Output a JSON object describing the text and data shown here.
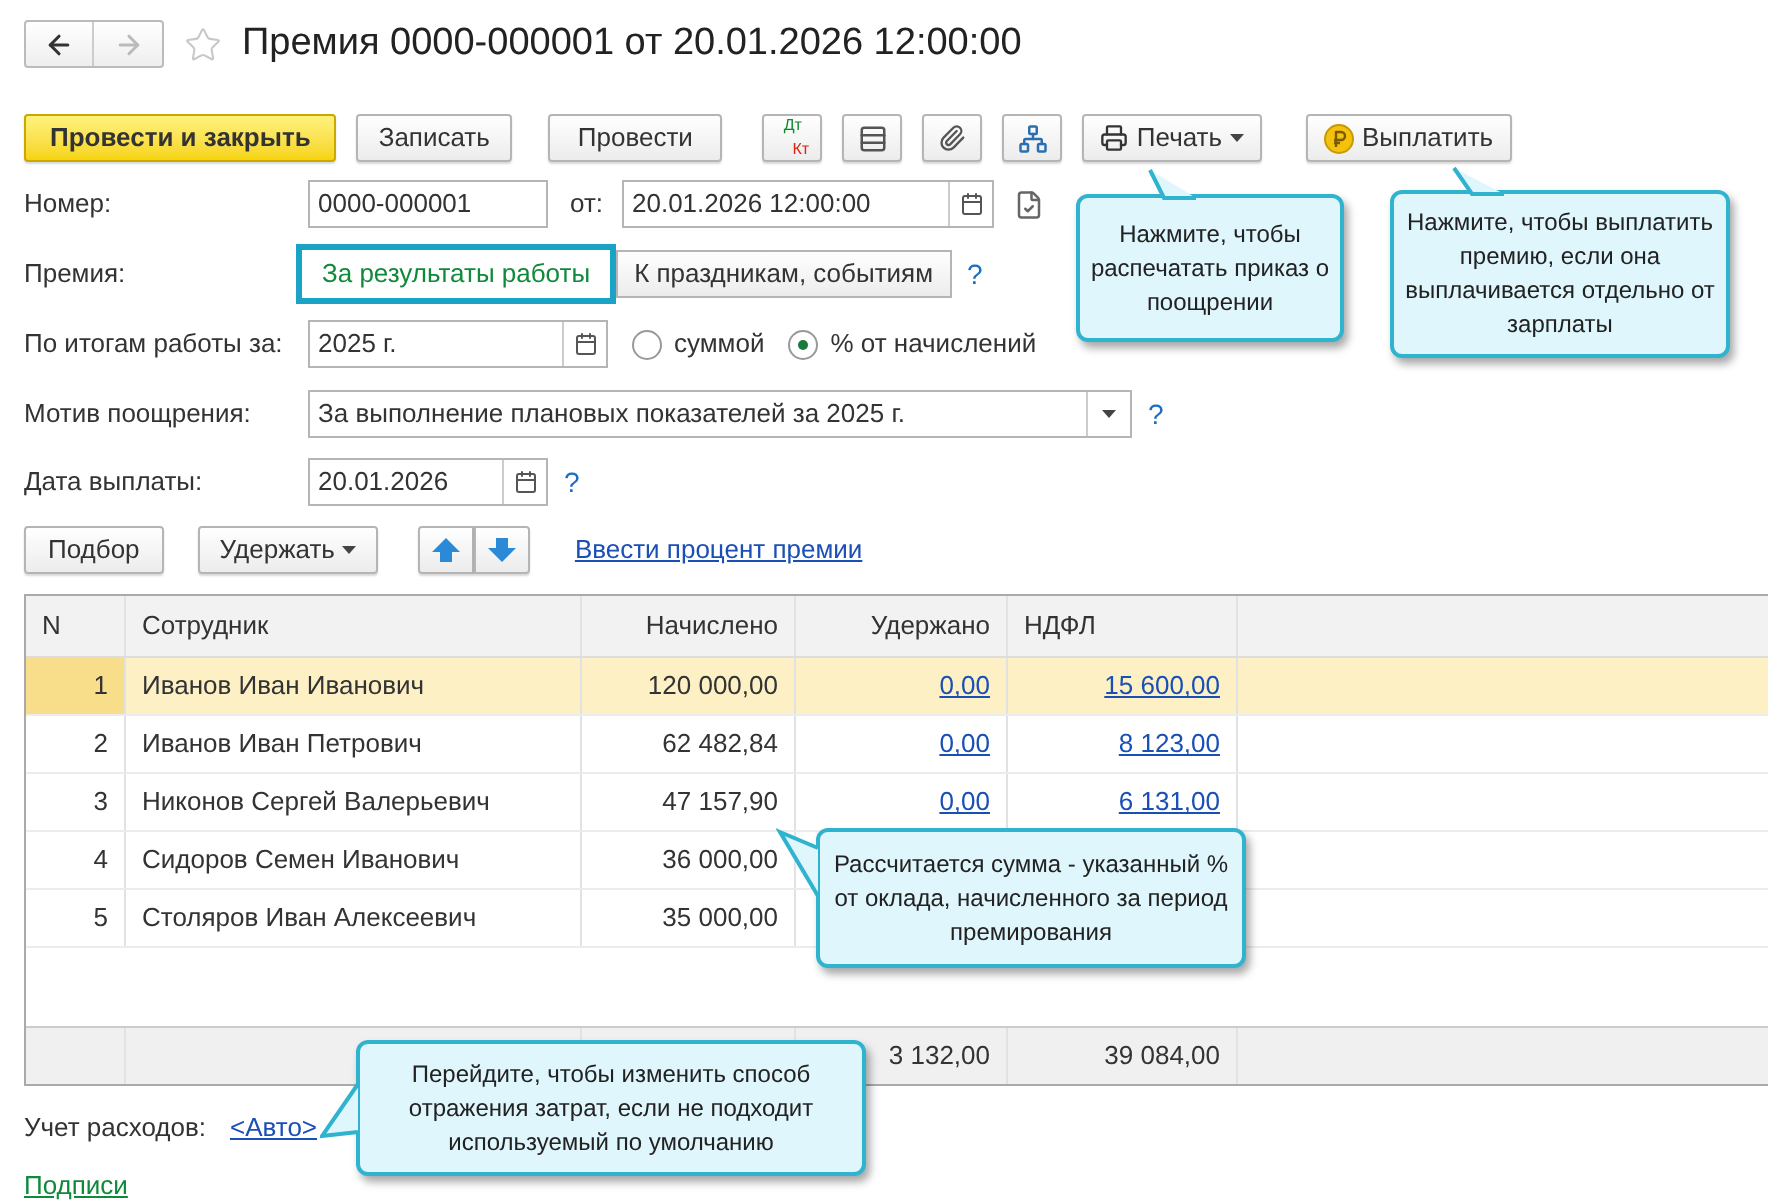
{
  "title": "Премия 0000-000001 от 20.01.2026 12:00:00",
  "toolbar": [
    {
      "kind": "primary",
      "label": "Провести и закрыть"
    },
    {
      "kind": "plain",
      "label": "Записать"
    },
    {
      "kind": "plain",
      "label": "Провести"
    },
    {
      "kind": "dtkt",
      "top": "Дт",
      "bottom": "Кт"
    },
    {
      "kind": "list"
    },
    {
      "kind": "clip"
    },
    {
      "kind": "structure"
    },
    {
      "kind": "print",
      "label": "Печать"
    },
    {
      "kind": "pay",
      "label": "Выплатить"
    }
  ],
  "number": {
    "label": "Номер:",
    "value": "0000-000001",
    "date_label": "от:",
    "date": "20.01.2026 12:00:00"
  },
  "premium": {
    "label": "Премия:",
    "options": [
      {
        "label": "За результаты работы",
        "selected": true
      },
      {
        "label": "К праздникам, событиям",
        "selected": false
      }
    ],
    "help": "?"
  },
  "period": {
    "label": "По итогам работы за:",
    "value": "2025 г.",
    "radios": [
      {
        "label": "суммой",
        "selected": false
      },
      {
        "label": "% от начислений",
        "selected": true
      }
    ]
  },
  "motive": {
    "label": "Мотив поощрения:",
    "value": "За выполнение плановых показателей за 2025 г.",
    "help": "?"
  },
  "pay_date": {
    "label": "Дата выплаты:",
    "value": "20.01.2026",
    "help": "?"
  },
  "table_actions": {
    "pick": "Подбор",
    "withhold": "Удержать",
    "link": "Ввести процент премии"
  },
  "table": {
    "columns": [
      "N",
      "Сотрудник",
      "Начислено",
      "Удержано",
      "НДФЛ"
    ],
    "rows": [
      {
        "n": "1",
        "name": "Иванов Иван Иванович",
        "accrued": "120 000,00",
        "withheld": "0,00",
        "ndfl": "15 600,00",
        "selected": true
      },
      {
        "n": "2",
        "name": "Иванов Иван Петрович",
        "accrued": "62 482,84",
        "withheld": "0,00",
        "ndfl": "8 123,00",
        "selected": false
      },
      {
        "n": "3",
        "name": "Никонов Сергей Валерьевич",
        "accrued": "47 157,90",
        "withheld": "0,00",
        "ndfl": "6 131,00",
        "selected": false
      },
      {
        "n": "4",
        "name": "Сидоров Семен Иванович",
        "accrued": "36 000,00",
        "selected": false
      },
      {
        "n": "5",
        "name": "Столяров Иван Алексеевич",
        "accrued": "35 000,00",
        "selected": false
      }
    ],
    "footer": {
      "withheld": "3 132,00",
      "ndfl": "39 084,00"
    }
  },
  "expenses": {
    "label": "Учет расходов:",
    "link": "<Авто>"
  },
  "signatures": "Подписи",
  "callouts": [
    "Нажмите, чтобы распечатать приказ о поощрении",
    "Нажмите, чтобы выплатить премию, если она выплачивается отдельно от зарплаты",
    "Рассчитается сумма - указанный % от оклада, начисленного за период премирования",
    "Перейдите, чтобы изменить способ отражения затрат, если не подходит используемый по умолчанию"
  ]
}
